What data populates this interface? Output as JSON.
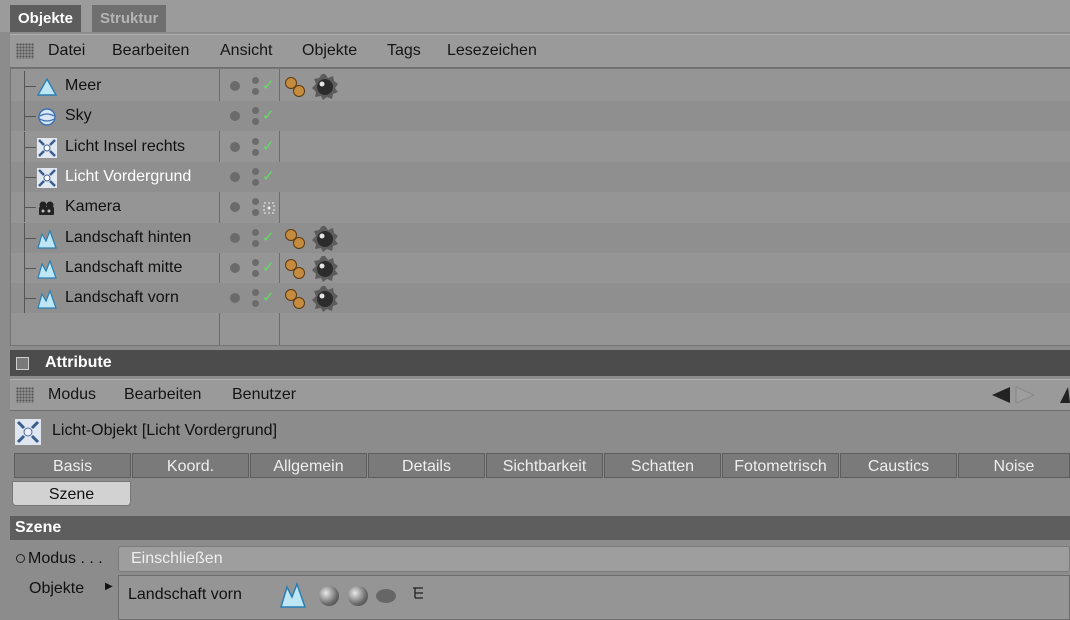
{
  "tabs": {
    "objects": "Objekte",
    "structure": "Struktur"
  },
  "menu": {
    "datei": "Datei",
    "bearbeiten": "Bearbeiten",
    "ansicht": "Ansicht",
    "objekte": "Objekte",
    "tags": "Tags",
    "lesezeichen": "Lesezeichen"
  },
  "objects": [
    {
      "label": "Meer",
      "icon": "plane-icon",
      "selected": false,
      "check": "✓",
      "tags": true
    },
    {
      "label": "Sky",
      "icon": "sky-icon",
      "selected": false,
      "check": "✓",
      "tags": false
    },
    {
      "label": "Licht Insel rechts",
      "icon": "light-icon",
      "selected": false,
      "check": "✓",
      "tags": false
    },
    {
      "label": "Licht Vordergrund",
      "icon": "light-icon",
      "selected": true,
      "check": "✓",
      "tags": false
    },
    {
      "label": "Kamera",
      "icon": "camera-icon",
      "selected": false,
      "check": "",
      "tags": false
    },
    {
      "label": "Landschaft hinten",
      "icon": "landscape-icon",
      "selected": false,
      "check": "✓",
      "tags": true
    },
    {
      "label": "Landschaft mitte",
      "icon": "landscape-icon",
      "selected": false,
      "check": "✓",
      "tags": true
    },
    {
      "label": "Landschaft vorn",
      "icon": "landscape-icon",
      "selected": false,
      "check": "✓",
      "tags": true
    }
  ],
  "attributes": {
    "title": "Attribute",
    "menu": {
      "modus": "Modus",
      "bearbeiten": "Bearbeiten",
      "benutzer": "Benutzer"
    },
    "object_title": "Licht-Objekt [Licht Vordergrund]",
    "tabs": [
      "Basis",
      "Koord.",
      "Allgemein",
      "Details",
      "Sichtbarkeit",
      "Schatten",
      "Fotometrisch",
      "Caustics",
      "Noise"
    ],
    "subtab": "Szene",
    "section": "Szene",
    "modus_label": "Modus . . .",
    "modus_value": "Einschließen",
    "objekte_label": "Objekte",
    "objekte_item": "Landschaft vorn"
  },
  "colors": {
    "check": "#5fe05f",
    "selected_text": "#ffffff",
    "panel": "#959595"
  }
}
